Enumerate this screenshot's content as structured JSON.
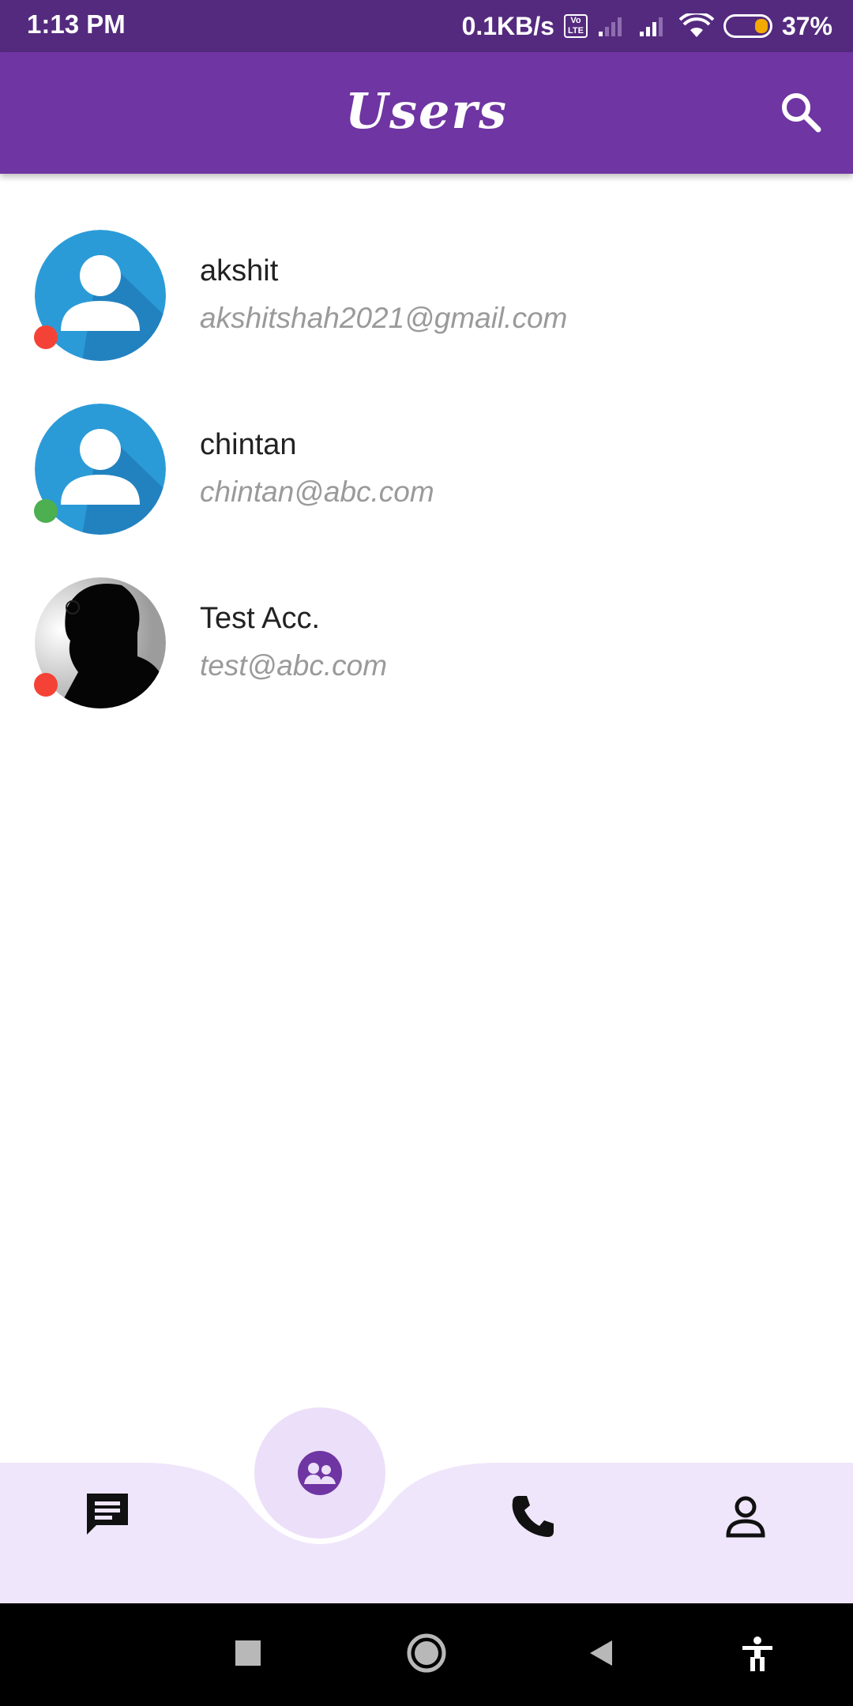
{
  "status_bar": {
    "time": "1:13 PM",
    "speed": "0.1KB/s",
    "volte_label": "Vo LTE",
    "battery": "37%"
  },
  "app_bar": {
    "title": "Users",
    "search_icon": "search-icon"
  },
  "users": [
    {
      "name": "akshit",
      "email": "akshitshah2021@gmail.com",
      "online": false,
      "avatar": "default-avatar"
    },
    {
      "name": "chintan",
      "email": "chintan@abc.com",
      "online": true,
      "avatar": "default-avatar"
    },
    {
      "name": "Test Acc.",
      "email": "test@abc.com",
      "online": false,
      "avatar": "photo-silhouette"
    }
  ],
  "bottom_nav": {
    "items": [
      "chat-icon",
      "users-icon",
      "phone-icon",
      "profile-icon"
    ],
    "selected": "users-icon"
  },
  "colors": {
    "status_bar": "#542a7e",
    "app_bar": "#6f35a2",
    "online": "#4caf50",
    "offline": "#f44336",
    "nav_bg": "#efe6fb",
    "accent": "#6f35a2"
  }
}
